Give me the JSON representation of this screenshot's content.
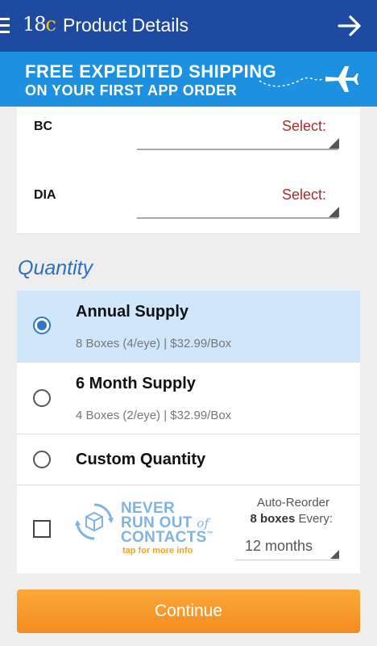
{
  "header": {
    "logo_main": "18",
    "logo_accent": "c",
    "title": "Product Details"
  },
  "banner": {
    "line1": "FREE EXPEDITED SHIPPING",
    "line2": "ON YOUR FIRST APP ORDER"
  },
  "prescription": {
    "fields": [
      {
        "label": "BC",
        "value": "Select:"
      },
      {
        "label": "DIA",
        "value": "Select:"
      }
    ]
  },
  "quantity": {
    "title": "Quantity",
    "options": [
      {
        "title": "Annual Supply",
        "subtitle": "8 Boxes (4/eye) | $32.99/Box",
        "selected": true
      },
      {
        "title": "6 Month Supply",
        "subtitle": "4 Boxes (2/eye) | $32.99/Box",
        "selected": false
      },
      {
        "title": "Custom Quantity",
        "subtitle": "",
        "selected": false
      }
    ],
    "auto_reorder": {
      "promo_line1": "NEVER",
      "promo_line2_a": "RUN OUT",
      "promo_line2_b": "of",
      "promo_line3": "CONTACTS",
      "trademark": "™",
      "promo_tap": "tap for more info",
      "label": "Auto-Reorder",
      "boxes_bold": "8 boxes",
      "boxes_rest": " Every:",
      "interval": "12 months",
      "checked": false
    }
  },
  "continue_label": "Continue",
  "colors": {
    "header": "#1e4ba1",
    "banner": "#1e90e0",
    "select_text": "#b02a2a",
    "accent": "#2f76c7",
    "selected_bg": "#cfe6fb",
    "button": "#f79a2a"
  },
  "icons": [
    "menu-icon",
    "arrow-right-icon",
    "airplane-icon",
    "box-recycle-icon",
    "radio-selected-icon"
  ]
}
